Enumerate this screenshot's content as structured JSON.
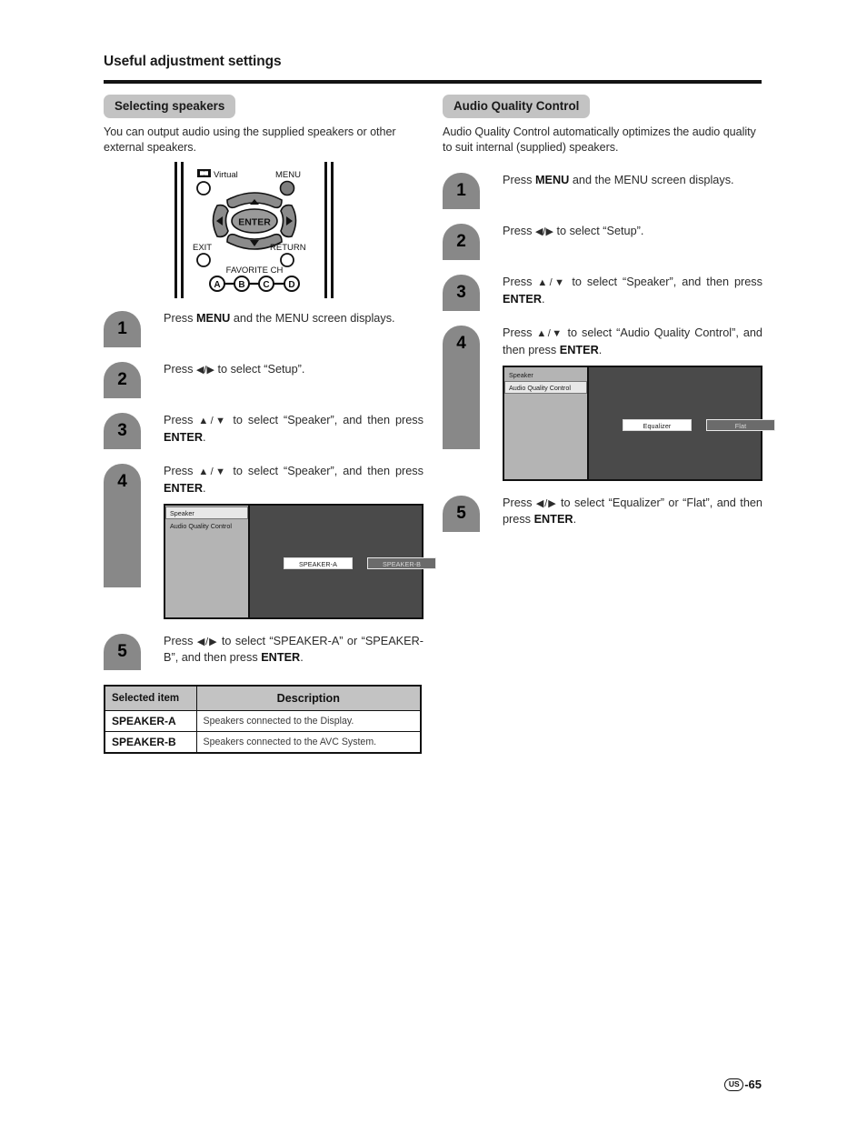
{
  "header": {
    "title": "Useful adjustment settings"
  },
  "left_column": {
    "section_title": "Selecting speakers",
    "intro": "You can output audio using the supplied speakers or other external speakers.",
    "remote": {
      "virtual_label": "Virtual",
      "dolby_icon": "dolby-double-d-icon",
      "menu_label": "MENU",
      "exit_label": "EXIT",
      "return_label": "RETURN",
      "enter_label": "ENTER",
      "favorite_ch_label": "FAVORITE CH",
      "favorite_buttons": [
        "A",
        "B",
        "C",
        "D"
      ],
      "up_arrow": "▲",
      "down_arrow": "▼",
      "left_arrow": "◀",
      "right_arrow": "▶"
    },
    "steps": [
      {
        "number": "1",
        "text_html": "Press <b>MENU</b> and the MENU screen displays."
      },
      {
        "number": "2",
        "text_html": "Press <span class=\"arrows\">◀/▶</span> to select “Setup”."
      },
      {
        "number": "3",
        "text_html": "Press <span class=\"arrows\">▲/▼</span> to select “Speaker”, and then press <b>ENTER</b>."
      },
      {
        "number": "4",
        "text_html": "Press <span class=\"arrows\">▲/▼</span> to select “Speaker”, and then press <b>ENTER</b>."
      },
      {
        "number": "5",
        "text_html": "Press <span class=\"arrows\">◀/▶</span> to select “SPEAKER-A” or “SPEAKER-B”, and then press <b>ENTER</b>."
      }
    ],
    "osd": {
      "menu_items": [
        "Speaker",
        "Audio Quality Control"
      ],
      "selected_menu_item": "Speaker",
      "buttons": [
        {
          "label": "SPEAKER-A",
          "state": "on"
        },
        {
          "label": "SPEAKER-B",
          "state": "off"
        }
      ]
    },
    "table": {
      "headers": [
        "Selected item",
        "Description"
      ],
      "rows": [
        {
          "item": "SPEAKER-A",
          "description": "Speakers connected to the Display."
        },
        {
          "item": "SPEAKER-B",
          "description": "Speakers connected to the AVC System."
        }
      ]
    }
  },
  "right_column": {
    "section_title": "Audio Quality Control",
    "intro": "Audio Quality Control automatically optimizes the audio quality to suit internal (supplied) speakers.",
    "steps": [
      {
        "number": "1",
        "text_html": "Press <b>MENU</b> and the MENU screen displays."
      },
      {
        "number": "2",
        "text_html": "Press <span class=\"arrows\">◀/▶</span> to select “Setup”."
      },
      {
        "number": "3",
        "text_html": "Press <span class=\"arrows\">▲/▼</span> to select “Speaker”, and then press <b>ENTER</b>."
      },
      {
        "number": "4",
        "text_html": "Press <span class=\"arrows\">▲/▼</span> to select “Audio Quality Control”, and then press <b>ENTER</b>."
      },
      {
        "number": "5",
        "text_html": "Press <span class=\"arrows\">◀/▶</span> to select “Equalizer” or “Flat”, and then press <b>ENTER</b>."
      }
    ],
    "osd": {
      "menu_items": [
        "Speaker",
        "Audio Quality Control"
      ],
      "selected_menu_item": "Audio Quality Control",
      "buttons": [
        {
          "label": "Equalizer",
          "state": "on"
        },
        {
          "label": "Flat",
          "state": "off"
        }
      ]
    }
  },
  "footer": {
    "region_badge": "US",
    "page_number": "-65"
  },
  "colors": {
    "section_bar": "#c3c3c3",
    "step_badge": "#888888",
    "osd_panel": "#4a4a4a",
    "osd_sidebar": "#b4b4b4",
    "rule": "#131313"
  }
}
